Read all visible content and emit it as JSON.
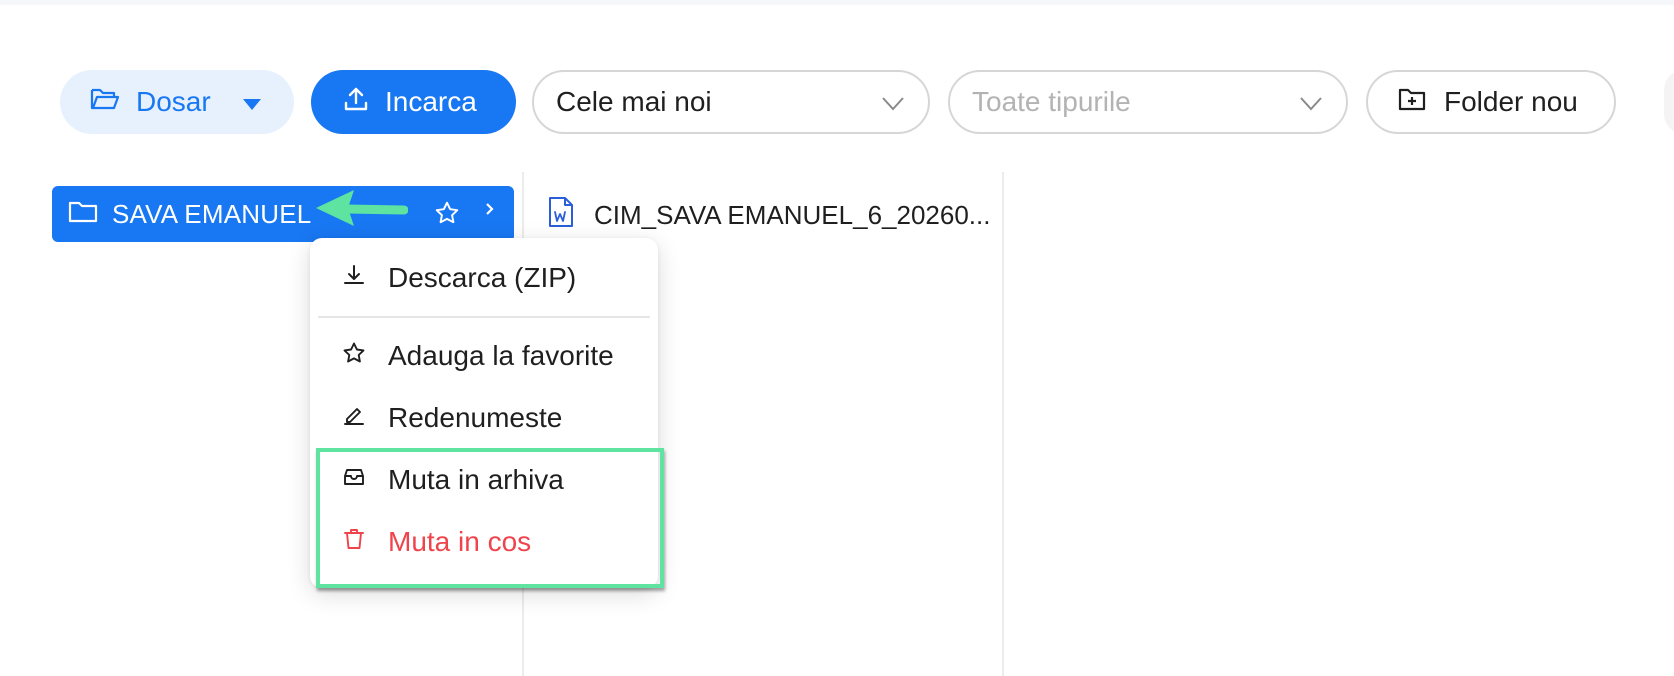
{
  "toolbar": {
    "dosar_label": "Dosar",
    "upload_label": "Incarca",
    "sort_value": "Cele mai noi",
    "type_placeholder": "Toate tipurile",
    "new_folder_label": "Folder nou"
  },
  "folders": [
    {
      "name": "SAVA EMANUEL",
      "selected": true
    }
  ],
  "files": [
    {
      "name": "CIM_SAVA EMANUEL_6_20260...",
      "icon": "word-document-icon"
    }
  ],
  "context_menu": {
    "items": [
      {
        "label": "Descarca (ZIP)",
        "icon": "download-icon"
      },
      {
        "label": "Adauga la favorite",
        "icon": "star-icon"
      },
      {
        "label": "Redenumeste",
        "icon": "pencil-icon"
      },
      {
        "label": "Muta in arhiva",
        "icon": "archive-icon"
      },
      {
        "label": "Muta in cos",
        "icon": "trash-icon",
        "danger": true
      }
    ]
  },
  "colors": {
    "accent": "#1877f2",
    "accent_light": "#e7f1fd",
    "danger": "#f0444c",
    "annotation": "#5fe3a1"
  }
}
